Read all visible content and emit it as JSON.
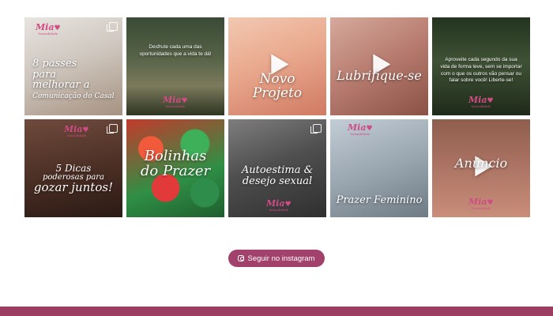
{
  "brand": {
    "logo_text": "Mia",
    "logo_sub": "Sexualidade",
    "accent_color": "#d14b86"
  },
  "posts": [
    {
      "caption_lines": [
        "8 passes",
        "para",
        "melhorar a",
        "Comunicação do Casal"
      ],
      "type": "carousel",
      "icon": "multi-photo-icon"
    },
    {
      "text": "Desfrute cada uma das oportunidades que a vida te dá!",
      "type": "image"
    },
    {
      "caption_lines": [
        "Novo",
        "Projeto"
      ],
      "type": "video",
      "icon": "play-icon"
    },
    {
      "caption_lines": [
        "Lubrifique-se"
      ],
      "type": "video",
      "icon": "play-icon"
    },
    {
      "text": "Aproveite cada segundo da sua vida de forma leve, sem se importar com o que os outros vão pensar ou falar sobre você! Liberte-se!",
      "type": "image"
    },
    {
      "caption_lines": [
        "5 Dicas",
        "poderosas para",
        "gozar juntos!"
      ],
      "type": "carousel",
      "icon": "multi-photo-icon"
    },
    {
      "caption_lines": [
        "Bolinhas",
        "do Prazer"
      ],
      "type": "image"
    },
    {
      "caption_lines": [
        "Autoestima &",
        "desejo sexual"
      ],
      "type": "carousel",
      "icon": "multi-photo-icon"
    },
    {
      "caption_lines": [
        "Prazer Feminino"
      ],
      "type": "image"
    },
    {
      "caption_lines": [
        "Anúncio"
      ],
      "type": "video",
      "icon": "play-icon"
    }
  ],
  "follow_button": {
    "label": "Seguir no instagram",
    "icon": "instagram-icon",
    "color": "#a2416b"
  },
  "footer": {
    "color": "#9c3d62"
  }
}
